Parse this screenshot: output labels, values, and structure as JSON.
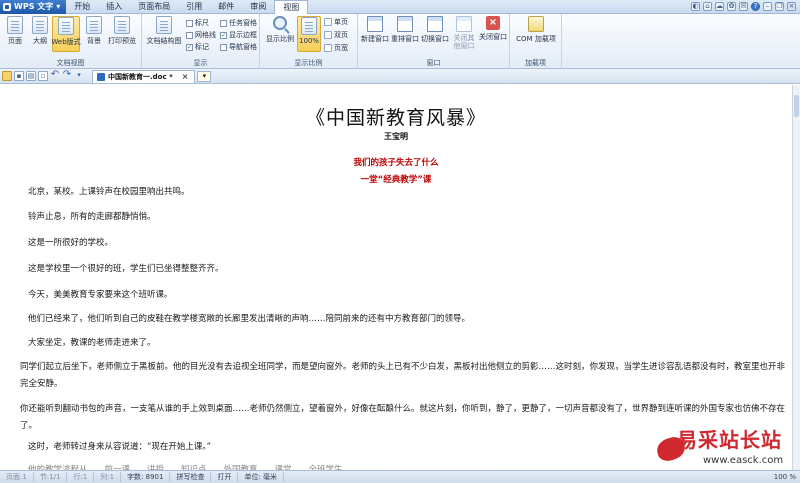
{
  "app": {
    "name": "WPS 文字",
    "menu_tabs": [
      "开始",
      "插入",
      "页面布局",
      "引用",
      "邮件",
      "审阅",
      "视图"
    ],
    "active_tab": "视图"
  },
  "ribbon": {
    "doc_view": {
      "label": "文档视图",
      "buttons": [
        "页面",
        "大纲",
        "Web版式",
        "背景",
        "打印预览"
      ]
    },
    "show": {
      "label": "显示",
      "structure_btn": "文档结构图",
      "checks": [
        {
          "label": "标尺",
          "checked": false
        },
        {
          "label": "网格线",
          "checked": false
        },
        {
          "label": "标记",
          "checked": true
        },
        {
          "label": "任务窗格",
          "checked": false
        },
        {
          "label": "显示边框",
          "checked": true
        },
        {
          "label": "导航窗格",
          "checked": false
        }
      ]
    },
    "zoom": {
      "label": "显示比例",
      "zoom_btn": "显示比例",
      "pct_btn": "100%",
      "single": "单页",
      "double": "双页",
      "page_width": "页宽"
    },
    "window": {
      "label": "窗口",
      "buttons": [
        "新建窗口",
        "重排窗口",
        "切换窗口",
        "关闭其他窗口",
        "关闭窗口"
      ]
    },
    "addins": {
      "label": "加载项",
      "com_btn": "COM 加载项"
    }
  },
  "tabbar": {
    "doc_name": "中国新教育一.doc *"
  },
  "document": {
    "title": "《中国新教育风暴》",
    "author": "王宝明",
    "subtitle1": "我们的孩子失去了什么",
    "subtitle2": "一堂“经典教学”课",
    "paragraphs": [
      "北京，某校。上课铃声在校园里响出共鸣。",
      "铃声止息，所有的走廊都静悄悄。",
      "这是一所很好的学校。",
      "这是学校里一个很好的班，学生们已坐得整整齐齐。",
      "今天，美美教育专家要来这个班听课。",
      "他们已经来了，他们听到自己的皮鞋在教学楼宽敞的长廊里发出清晰的声响……陪同前来的还有中方教育部门的领导。",
      "大家坐定，教课的老师走进来了。",
      "同学们起立后坐下，老师侧立于黑板前。他的目光没有去追视全班同学，而是望向窗外。老师的头上已有不少白发，黑板衬出他侧立的剪影……这时刻，你发现，当学生进诊容乱语都没有时，教室里也开非完全安静。",
      "你还能听到翻动书包的声音，一支笔从谁的手上效到桌面……老师仍然侧立，望着窗外，好像在酝酿什么。就这片刻，你听到，静了，更静了，一切声音都没有了，世界静到连听课的外国专家也仿佛不存在了。",
      "这时，老师转过身来从容说道：“现在开始上课。”",
      "他的教学流程从……前一课……讲授……知识点……外国教育……课堂……全班学生……"
    ]
  },
  "statusbar": {
    "items": [
      "页面:1",
      "节:1/1",
      "行:1",
      "列:1",
      "字数: 8901",
      "拼写检查",
      "打开",
      "单位: 毫米"
    ],
    "zoom": "100 %"
  },
  "watermark": {
    "cn": "易采站长站",
    "url": "www.easck.com"
  }
}
